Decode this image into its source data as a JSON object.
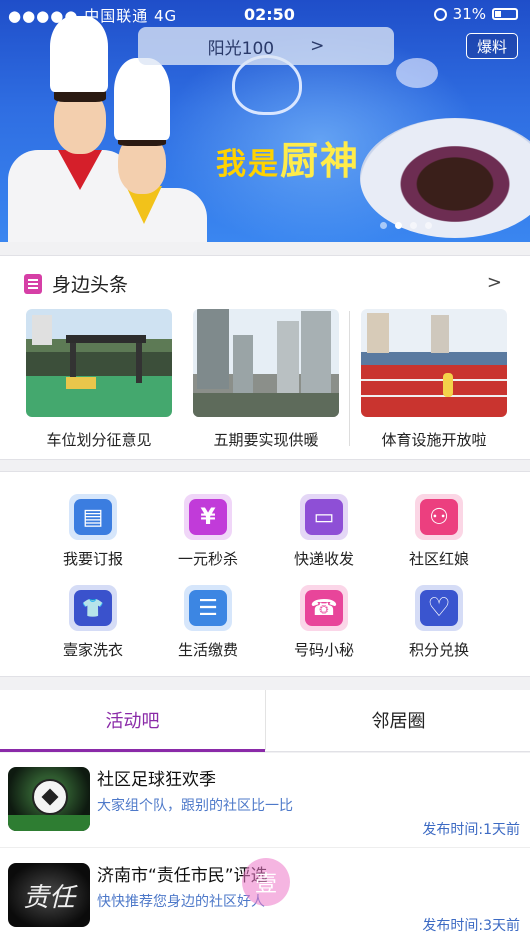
{
  "status_bar": {
    "carrier": "●●●●● 中国联通 4G",
    "time": "02:50",
    "battery": "31%"
  },
  "header": {
    "search_text": "阳光100",
    "search_arrow": ">",
    "report_label": "爆料"
  },
  "banner": {
    "title_prefix": "我是",
    "title_emphasis": "厨神"
  },
  "news": {
    "title": "身边头条",
    "more": ">",
    "items": [
      {
        "caption": "车位划分征意见"
      },
      {
        "caption": "五期要实现供暖"
      },
      {
        "caption": "体育设施开放啦"
      }
    ]
  },
  "services": [
    {
      "label": "我要订报",
      "icon": "newspaper-icon",
      "color": "#3b7de0",
      "glyph": "▤"
    },
    {
      "label": "一元秒杀",
      "icon": "yuan-icon",
      "color": "#c13bd9",
      "glyph": "¥"
    },
    {
      "label": "快递收发",
      "icon": "package-icon",
      "color": "#8e4fd6",
      "glyph": "▭"
    },
    {
      "label": "社区红娘",
      "icon": "people-icon",
      "color": "#ec3f7f",
      "glyph": "⚇"
    },
    {
      "label": "壹家洗衣",
      "icon": "shirt-icon",
      "color": "#3a52cc",
      "glyph": "👕"
    },
    {
      "label": "生活缴费",
      "icon": "bill-icon",
      "color": "#3c86e3",
      "glyph": "☰"
    },
    {
      "label": "号码小秘",
      "icon": "phone-icon",
      "color": "#e8459a",
      "glyph": "☎"
    },
    {
      "label": "积分兑换",
      "icon": "heart-icon",
      "color": "#3a55cf",
      "glyph": "♡"
    }
  ],
  "tabs": [
    {
      "label": "活动吧"
    },
    {
      "label": "邻居圈"
    }
  ],
  "activities": [
    {
      "title": "社区足球狂欢季",
      "desc": "大家组个队，跟别的社区比一比",
      "time": "发布时间:1天前"
    },
    {
      "title": "济南市“责任市民”评选",
      "desc": "快快推荐您身边的社区好人",
      "time": "发布时间:3天前",
      "thumb_text": "责任"
    }
  ],
  "float_button": {
    "label": "壹"
  }
}
